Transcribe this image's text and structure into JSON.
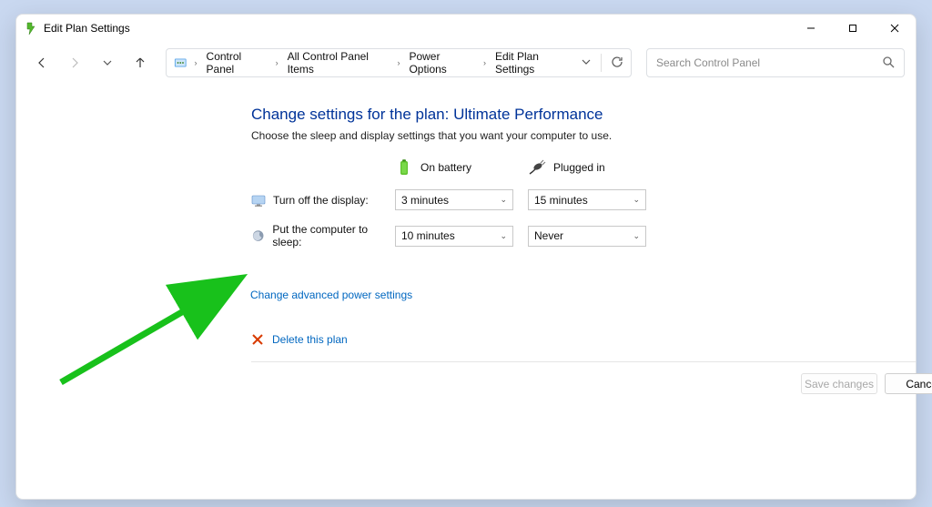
{
  "window": {
    "title": "Edit Plan Settings"
  },
  "breadcrumbs": {
    "a": "Control Panel",
    "b": "All Control Panel Items",
    "c": "Power Options",
    "d": "Edit Plan Settings"
  },
  "search": {
    "placeholder": "Search Control Panel"
  },
  "page": {
    "heading": "Change settings for the plan: Ultimate Performance",
    "sub": "Choose the sleep and display settings that you want your computer to use.",
    "col_battery": "On battery",
    "col_plugged": "Plugged in",
    "row_display_label": "Turn off the display:",
    "row_display_battery": "3 minutes",
    "row_display_plugged": "15 minutes",
    "row_sleep_label": "Put the computer to sleep:",
    "row_sleep_battery": "10 minutes",
    "row_sleep_plugged": "Never",
    "link_advanced": "Change advanced power settings",
    "link_delete": "Delete this plan",
    "btn_save": "Save changes",
    "btn_cancel": "Cancel"
  }
}
